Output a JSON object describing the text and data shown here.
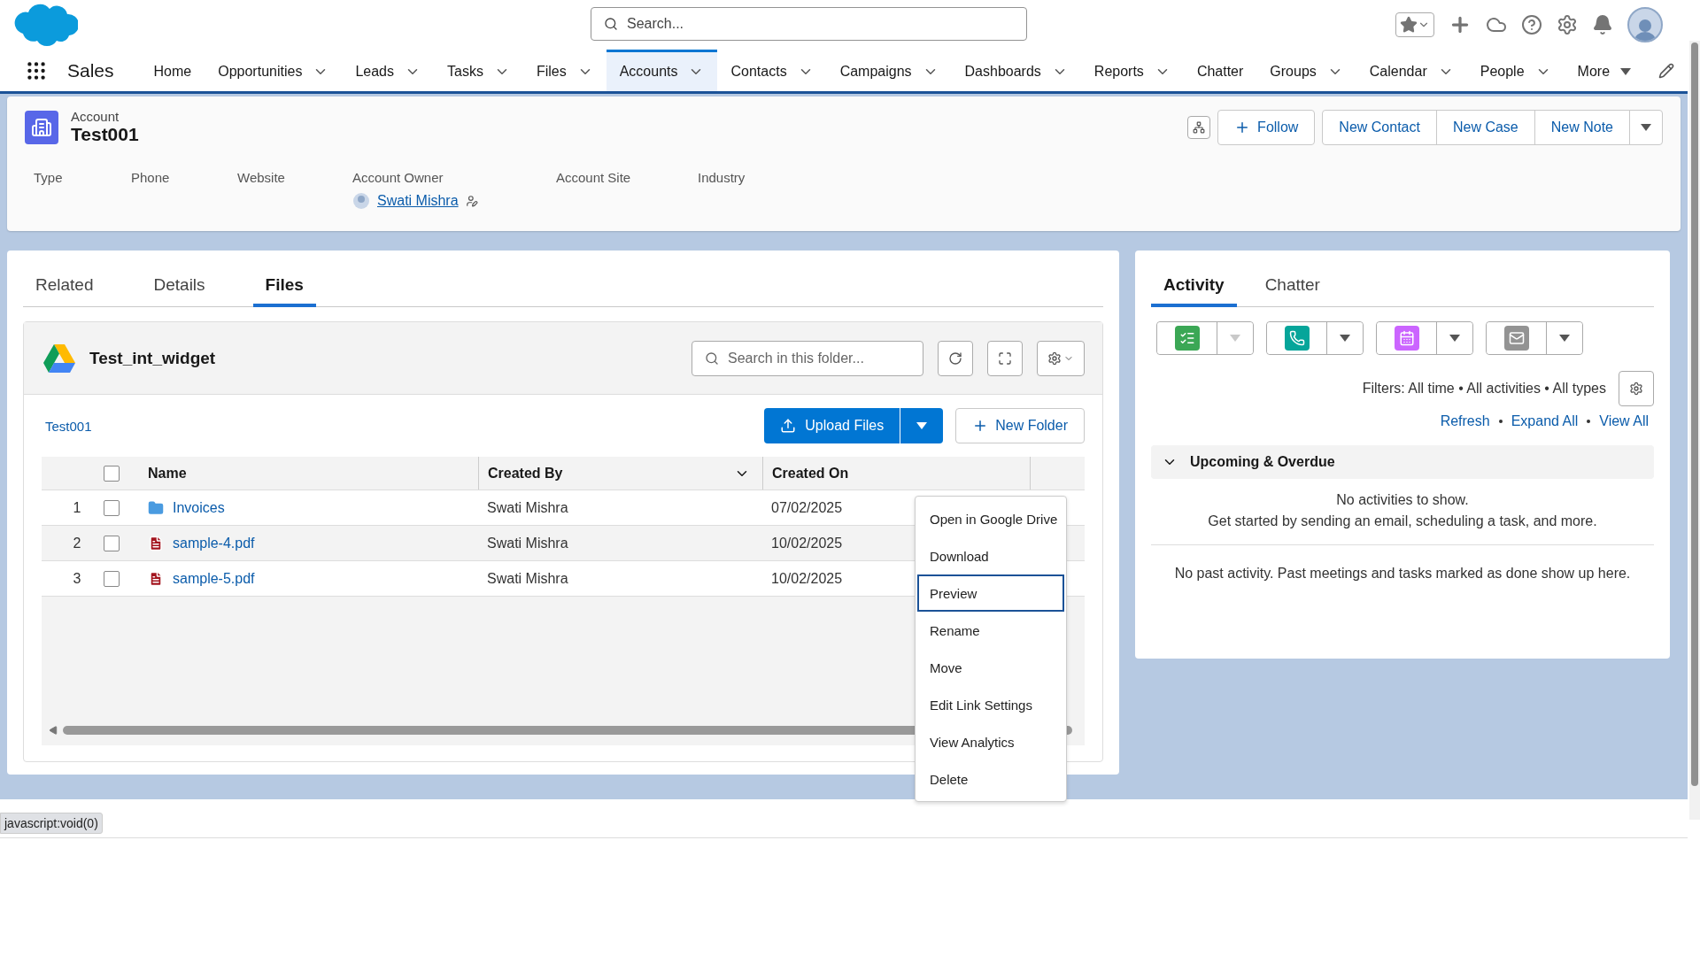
{
  "top_bar": {
    "search": {
      "placeholder": "Search..."
    }
  },
  "nav": {
    "app_name": "Sales",
    "items": [
      {
        "label": "Home",
        "kind": "link",
        "selected": false
      },
      {
        "label": "Opportunities",
        "kind": "menu",
        "selected": false
      },
      {
        "label": "Leads",
        "kind": "menu",
        "selected": false
      },
      {
        "label": "Tasks",
        "kind": "menu",
        "selected": false
      },
      {
        "label": "Files",
        "kind": "menu",
        "selected": false
      },
      {
        "label": "Accounts",
        "kind": "menu",
        "selected": true
      },
      {
        "label": "Contacts",
        "kind": "menu",
        "selected": false
      },
      {
        "label": "Campaigns",
        "kind": "menu",
        "selected": false
      },
      {
        "label": "Dashboards",
        "kind": "menu",
        "selected": false
      },
      {
        "label": "Reports",
        "kind": "menu",
        "selected": false
      },
      {
        "label": "Chatter",
        "kind": "link",
        "selected": false
      },
      {
        "label": "Groups",
        "kind": "menu",
        "selected": false
      },
      {
        "label": "Calendar",
        "kind": "menu",
        "selected": false
      },
      {
        "label": "People",
        "kind": "menu",
        "selected": false
      },
      {
        "label": "More",
        "kind": "more",
        "selected": false
      }
    ]
  },
  "record": {
    "object_label": "Account",
    "title": "Test001",
    "actions": [
      "Follow",
      "New Contact",
      "New Case",
      "New Note"
    ],
    "fields": [
      {
        "label": "Type"
      },
      {
        "label": "Phone"
      },
      {
        "label": "Website"
      },
      {
        "label": "Account Owner",
        "value": "Swati Mishra"
      },
      {
        "label": "Account Site"
      },
      {
        "label": "Industry"
      }
    ]
  },
  "main_tabs": [
    {
      "label": "Related",
      "selected": false
    },
    {
      "label": "Details",
      "selected": false
    },
    {
      "label": "Files",
      "selected": true
    }
  ],
  "drive_widget": {
    "title": "Test_int_widget",
    "search": {
      "placeholder": "Search in this folder..."
    },
    "breadcrumb": "Test001",
    "upload_button": "Upload Files",
    "new_folder_button": "New Folder",
    "columns": [
      "Name",
      "Created By",
      "Created On"
    ],
    "select_all_checked": false,
    "rows": [
      {
        "number": "1",
        "kind": "folder",
        "name": "Invoices",
        "created_by": "Swati Mishra",
        "created_on": "07/02/2025",
        "checked": false,
        "selected": false
      },
      {
        "number": "2",
        "kind": "pdf",
        "name": "sample-4.pdf",
        "created_by": "Swati Mishra",
        "created_on": "10/02/2025",
        "checked": false,
        "selected": true
      },
      {
        "number": "3",
        "kind": "pdf",
        "name": "sample-5.pdf",
        "created_by": "Swati Mishra",
        "created_on": "10/02/2025",
        "checked": false,
        "selected": false
      }
    ]
  },
  "context_menu": [
    {
      "label": "Open in Google Drive",
      "selected": false
    },
    {
      "label": "Download",
      "selected": false
    },
    {
      "label": "Preview",
      "selected": true
    },
    {
      "label": "Rename",
      "selected": false
    },
    {
      "label": "Move",
      "selected": false
    },
    {
      "label": "Edit Link Settings",
      "selected": false
    },
    {
      "label": "View Analytics",
      "selected": false
    },
    {
      "label": "Delete",
      "selected": false
    }
  ],
  "activity": {
    "tabs": [
      {
        "label": "Activity",
        "selected": true
      },
      {
        "label": "Chatter",
        "selected": false
      }
    ],
    "quick_actions": [
      {
        "kind": "task",
        "color": "#3ba755",
        "disabled": true
      },
      {
        "kind": "call",
        "color": "#06a59a",
        "disabled": false
      },
      {
        "kind": "event",
        "color": "#cb65ff",
        "disabled": false
      },
      {
        "kind": "email",
        "color": "#939393",
        "disabled": false
      }
    ],
    "filters": "Filters: All time • All activities • All types",
    "links": [
      "Refresh",
      "Expand All",
      "View All"
    ],
    "section": {
      "title": "Upcoming & Overdue",
      "expanded": true
    },
    "empty_lines": [
      "No activities to show.",
      "Get started by sending an email, scheduling a task, and more."
    ],
    "past_note": "No past activity. Past meetings and tasks marked as done show up here."
  },
  "status_tooltip": "javascript:void(0)"
}
